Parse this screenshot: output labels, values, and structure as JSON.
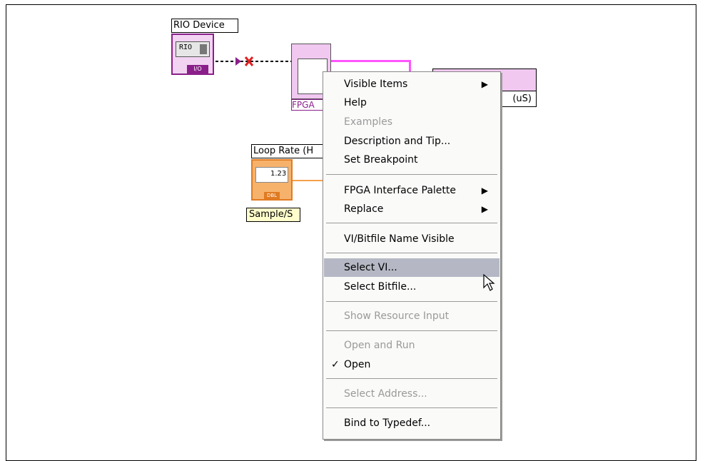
{
  "diagram": {
    "rio_device_label": "RIO Device",
    "rio_control_text": "RIO",
    "rio_io_tag": "I/O",
    "fpga_label": "FPGA",
    "read_label_text": "(uS)",
    "loop_rate_label": "Loop Rate (H",
    "numeric_text": "1.23",
    "dbl_tag": "DBL",
    "sample_label": "Sample/S"
  },
  "context_menu": {
    "items": [
      {
        "label": "Visible Items",
        "submenu": true,
        "enabled": true
      },
      {
        "label": "Help",
        "enabled": true
      },
      {
        "label": "Examples",
        "enabled": false
      },
      {
        "label": "Description and Tip...",
        "enabled": true
      },
      {
        "label": "Set Breakpoint",
        "enabled": true
      },
      {
        "label": "FPGA Interface Palette",
        "submenu": true,
        "enabled": true
      },
      {
        "label": "Replace",
        "submenu": true,
        "enabled": true
      },
      {
        "label": "VI/Bitfile Name Visible",
        "enabled": true
      },
      {
        "label": "Select VI...",
        "enabled": true,
        "highlighted": true
      },
      {
        "label": "Select Bitfile...",
        "enabled": true
      },
      {
        "label": "Show Resource Input",
        "enabled": false
      },
      {
        "label": "Open and Run",
        "enabled": false
      },
      {
        "label": "Open",
        "enabled": true,
        "checked": true
      },
      {
        "label": "Select Address...",
        "enabled": false
      },
      {
        "label": "Bind to Typedef...",
        "enabled": true
      }
    ],
    "submenu_arrow": "▶",
    "check_mark": "✓"
  },
  "colors": {
    "highlight": "#b5b8c4",
    "rio_purple": "#8a1f8a",
    "wire_pink": "#ff55ff",
    "control_orange": "#e07b22"
  }
}
